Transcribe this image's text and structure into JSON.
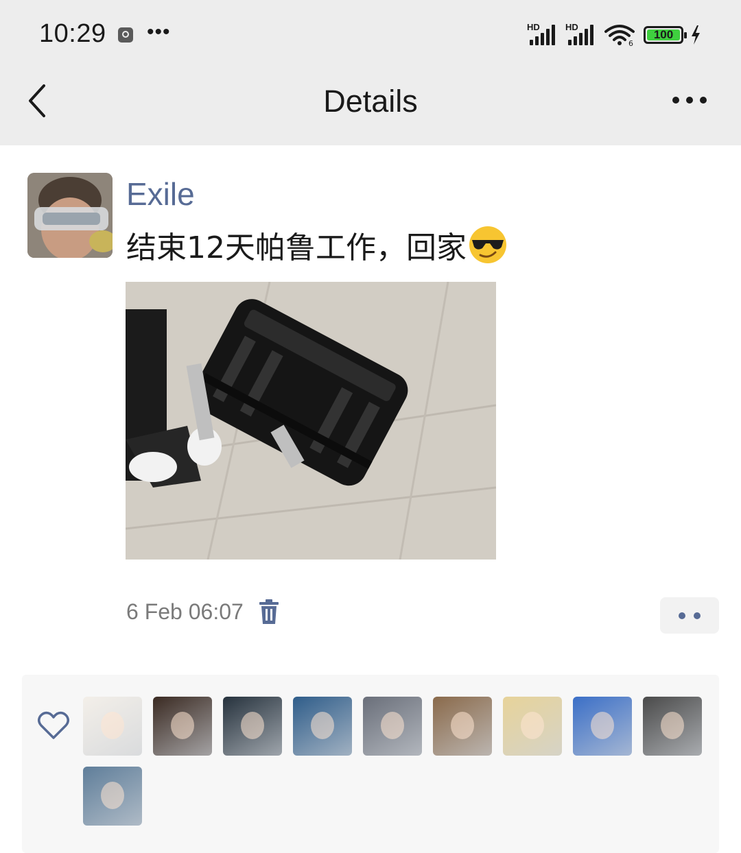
{
  "status_bar": {
    "time": "10:29",
    "signal_label_1": "HD",
    "signal_label_2": "HD",
    "wifi_sub": "6",
    "battery": "100"
  },
  "nav": {
    "title": "Details",
    "back_icon": "chevron-left-icon",
    "more_icon": "more-horizontal-icon"
  },
  "post": {
    "author": "Exile",
    "text": "结束12天帕鲁工作，回家",
    "emoji": "sunglasses-face-emoji",
    "timestamp": "6 Feb 06:07",
    "delete_icon": "trash-icon"
  },
  "likes": {
    "icon": "heart-icon",
    "avatars": [
      {
        "name": "liker-1",
        "color": "#f3efe9"
      },
      {
        "name": "liker-2",
        "color": "#3a2a22"
      },
      {
        "name": "liker-3",
        "color": "#26323d"
      },
      {
        "name": "liker-4",
        "color": "#2f5d8a"
      },
      {
        "name": "liker-5",
        "color": "#6a6f7a"
      },
      {
        "name": "liker-6",
        "color": "#8a6a4b"
      },
      {
        "name": "liker-7",
        "color": "#e7d39a"
      },
      {
        "name": "liker-8",
        "color": "#3b6fc7"
      },
      {
        "name": "liker-9",
        "color": "#4a4a4a"
      },
      {
        "name": "liker-10",
        "color": "#5f7e9a"
      }
    ]
  },
  "colors": {
    "link": "#576b95",
    "header_bg": "#ededed",
    "likes_bg": "#f7f7f7"
  }
}
